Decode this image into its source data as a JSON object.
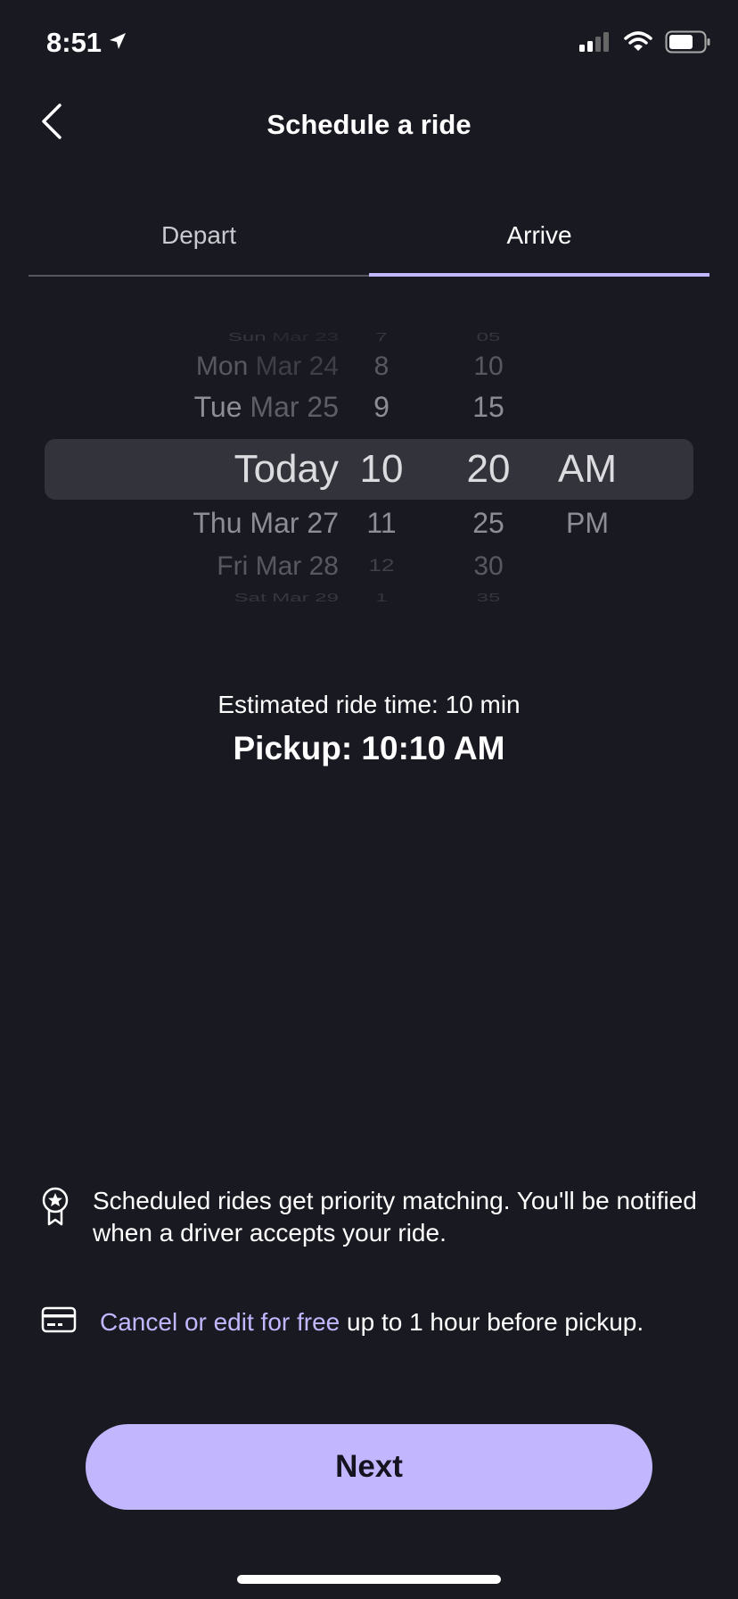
{
  "status_bar": {
    "time": "8:51"
  },
  "header": {
    "title": "Schedule a ride"
  },
  "tabs": [
    {
      "label": "Depart",
      "active": false
    },
    {
      "label": "Arrive",
      "active": true
    }
  ],
  "picker": {
    "dates": [
      {
        "day": "Sun",
        "date": "Mar 23"
      },
      {
        "day": "Mon",
        "date": "Mar 24"
      },
      {
        "day": "Tue",
        "date": "Mar 25"
      },
      {
        "day": "Today",
        "date": ""
      },
      {
        "day": "Thu",
        "date": "Mar 27"
      },
      {
        "day": "Fri",
        "date": "Mar 28"
      },
      {
        "day": "Sat",
        "date": "Mar 29"
      }
    ],
    "hours": [
      "7",
      "8",
      "9",
      "10",
      "11",
      "12",
      "1"
    ],
    "minutes": [
      "05",
      "10",
      "15",
      "20",
      "25",
      "30",
      "35"
    ],
    "ampm": [
      "AM",
      "PM"
    ]
  },
  "estimate": {
    "ride_time": "Estimated ride time: 10 min",
    "pickup": "Pickup: 10:10 AM"
  },
  "info": {
    "priority_text": "Scheduled rides get priority matching. You'll be notified when a driver accepts your ride.",
    "cancel_link": "Cancel or edit for free",
    "cancel_rest": " up to 1 hour before pickup."
  },
  "next_button": {
    "label": "Next"
  },
  "colors": {
    "background": "#191921",
    "accent": "#c2b7ff"
  },
  "icons": [
    "location-arrow-icon",
    "signal-icon",
    "wifi-icon",
    "battery-icon",
    "back-chevron-icon",
    "award-star-icon",
    "credit-card-icon"
  ]
}
